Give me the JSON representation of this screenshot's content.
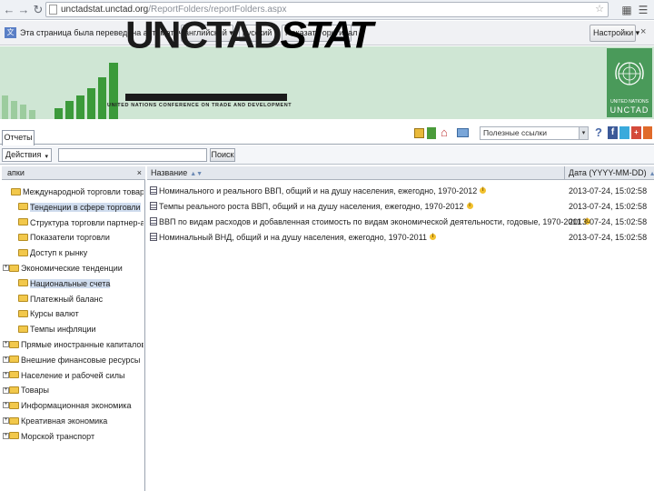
{
  "browser": {
    "url_host": "unctadstat.unctad.org",
    "url_path": "/ReportFolders/reportFolders.aspx",
    "translate_message": "Эта страница была переведена автоматически",
    "from_language": "английский",
    "to_language": "русский",
    "show_original_label": "Показать оригинал",
    "settings_label": "Настройки"
  },
  "banner": {
    "logo_unctad": "UNCTAD",
    "logo_stat": "STAT",
    "logo_subtitle": "UNITED NATIONS CONFERENCE ON TRADE AND DEVELOPMENT",
    "emblem_caption_1": "UNITED NATIONS",
    "emblem_caption_2": "UNCTAD",
    "bar_color": "#3b9a3a",
    "background_color": "#cfe6d4"
  },
  "toolbar": {
    "reports_tab": "Отчеты",
    "quick_links": "Полезные ссылки",
    "actions_label": "Действия",
    "search_value": "",
    "search_button": "Поиск",
    "header_icons": [
      "lock-icon",
      "home-icon",
      "mail-icon",
      "help-icon",
      "facebook-icon",
      "twitter-icon",
      "share-icon"
    ]
  },
  "left_pane": {
    "header": "апки",
    "close_glyph": "×",
    "items": [
      {
        "label": "Международной торговли товарами и",
        "expander": "",
        "level": 0,
        "selected": false
      },
      {
        "label": "Тенденции в сфере торговли",
        "expander": "",
        "level": 1,
        "selected": true
      },
      {
        "label": "Структура торговли партнер-а",
        "expander": "",
        "level": 1,
        "selected": false
      },
      {
        "label": "Показатели торговли",
        "expander": "",
        "level": 1,
        "selected": false
      },
      {
        "label": "Доступ к рынку",
        "expander": "",
        "level": 1,
        "selected": false
      },
      {
        "label": "Экономические тенденции",
        "expander": "+",
        "level": 0,
        "selected": false
      },
      {
        "label": "Национальные счета",
        "expander": "",
        "level": 1,
        "selected": true
      },
      {
        "label": "Платежный баланс",
        "expander": "",
        "level": 1,
        "selected": false
      },
      {
        "label": "Курсы валют",
        "expander": "",
        "level": 1,
        "selected": false
      },
      {
        "label": "Темпы инфляции",
        "expander": "",
        "level": 1,
        "selected": false
      },
      {
        "label": "Прямые иностранные капиталовложен",
        "expander": "+",
        "level": 0,
        "selected": false
      },
      {
        "label": "Внешние финансовые ресурсы",
        "expander": "+",
        "level": 0,
        "selected": false
      },
      {
        "label": "Население и рабочей силы",
        "expander": "+",
        "level": 0,
        "selected": false
      },
      {
        "label": "Товары",
        "expander": "+",
        "level": 0,
        "selected": false
      },
      {
        "label": "Информационная экономика",
        "expander": "+",
        "level": 0,
        "selected": false
      },
      {
        "label": "Креативная экономика",
        "expander": "+",
        "level": 0,
        "selected": false
      },
      {
        "label": "Морской транспорт",
        "expander": "+",
        "level": 0,
        "selected": false
      }
    ]
  },
  "grid": {
    "col_name": "Название",
    "col_date": "Дата (YYYY-MM-DD)",
    "rows": [
      {
        "name": "Номинального и реального ВВП, общий и на душу населения, ежегодно, 1970-2012",
        "date": "2013-07-24, 15:02:58"
      },
      {
        "name": "Темпы реального роста ВВП, общий и на душу населения, ежегодно, 1970-2012",
        "date": "2013-07-24, 15:02:58"
      },
      {
        "name": "ВВП по видам расходов и добавленная стоимость по видам экономической деятельности, годовые, 1970-2011",
        "date": "2013-07-24, 15:02:58"
      },
      {
        "name": "Номинальный ВНД, общий и на душу населения, ежегодно, 1970-2011",
        "date": "2013-07-24, 15:02:58"
      }
    ]
  }
}
